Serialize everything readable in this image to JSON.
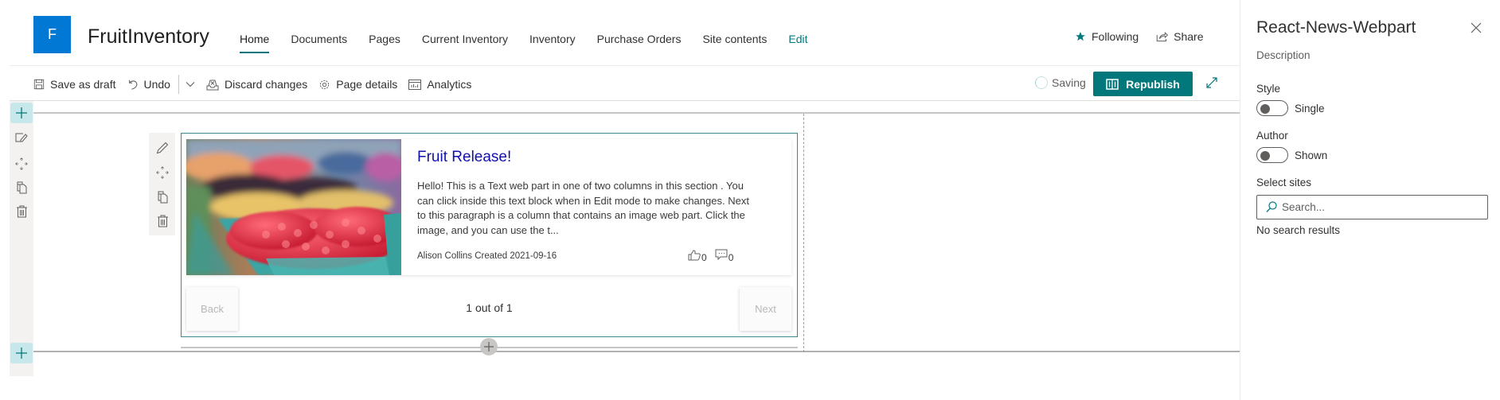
{
  "site": {
    "logo_letter": "F",
    "title": "FruitInventory",
    "nav": [
      {
        "label": "Home",
        "active": true
      },
      {
        "label": "Documents"
      },
      {
        "label": "Pages"
      },
      {
        "label": "Current Inventory"
      },
      {
        "label": "Inventory"
      },
      {
        "label": "Purchase Orders"
      },
      {
        "label": "Site contents"
      },
      {
        "label": "Edit"
      }
    ],
    "actions": {
      "following": "Following",
      "share": "Share"
    },
    "colors": {
      "brand": "#0078d4",
      "accent": "#03787c",
      "title_link": "#1111aa"
    }
  },
  "commandbar": {
    "save_draft": "Save as draft",
    "undo": "Undo",
    "discard": "Discard changes",
    "page_details": "Page details",
    "analytics": "Analytics",
    "status": "Saving",
    "republish": "Republish"
  },
  "news": {
    "title": "Fruit Release!",
    "excerpt": "Hello! This is a Text web part in one of two columns in this section . You can click inside this text block when in Edit mode to make changes. Next to this paragraph is a column that contains an image web part. Click the image, and you can use the t...",
    "meta": "Alison Collins Created 2021-09-16",
    "likes": "0",
    "comments": "0",
    "back": "Back",
    "next": "Next",
    "pager": "1 out of 1"
  },
  "pane": {
    "title": "React-News-Webpart",
    "description": "Description",
    "style_label": "Style",
    "style_value": "Single",
    "style_on": false,
    "author_label": "Author",
    "author_value": "Shown",
    "author_on": false,
    "sites_label": "Select sites",
    "search_placeholder": "Search...",
    "no_results": "No search results"
  }
}
